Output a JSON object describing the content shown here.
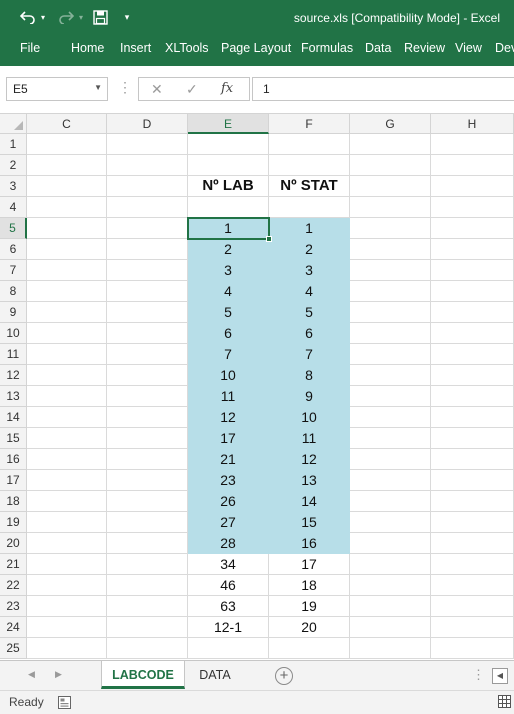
{
  "title_bar": {
    "title": "source.xls  [Compatibility Mode] - Excel",
    "undo_icon": "undo-icon",
    "redo_icon": "redo-icon",
    "save_icon": "save-icon"
  },
  "ribbon": {
    "tabs": [
      "File",
      "Home",
      "Insert",
      "XLTools",
      "Page Layout",
      "Formulas",
      "Data",
      "Review",
      "View",
      "Dev"
    ]
  },
  "formula_bar": {
    "name_box": "E5",
    "fx_label": "fx",
    "content": "1"
  },
  "grid": {
    "columns": [
      "C",
      "D",
      "E",
      "F",
      "G",
      "H"
    ],
    "selected_column": "E",
    "rows": [
      "1",
      "2",
      "3",
      "4",
      "5",
      "6",
      "7",
      "8",
      "9",
      "10",
      "11",
      "12",
      "13",
      "14",
      "15",
      "16",
      "17",
      "18",
      "19",
      "20",
      "21",
      "22",
      "23",
      "24",
      "25"
    ],
    "selected_row": "5",
    "highlight_color": "#b7dee8",
    "header_e": "Nº LAB",
    "header_f": "Nº STAT",
    "col_e": [
      "1",
      "2",
      "3",
      "4",
      "5",
      "6",
      "7",
      "10",
      "11",
      "12",
      "17",
      "21",
      "23",
      "26",
      "27",
      "28",
      "34",
      "46",
      "63",
      "12-1"
    ],
    "col_f": [
      "1",
      "2",
      "3",
      "4",
      "5",
      "6",
      "7",
      "8",
      "9",
      "10",
      "11",
      "12",
      "13",
      "14",
      "15",
      "16",
      "17",
      "18",
      "19",
      "20"
    ]
  },
  "sheet_tabs": {
    "tabs": [
      "LABCODE",
      "DATA"
    ],
    "active": "LABCODE"
  },
  "status_bar": {
    "text": "Ready"
  },
  "colors": {
    "accent": "#217346"
  }
}
